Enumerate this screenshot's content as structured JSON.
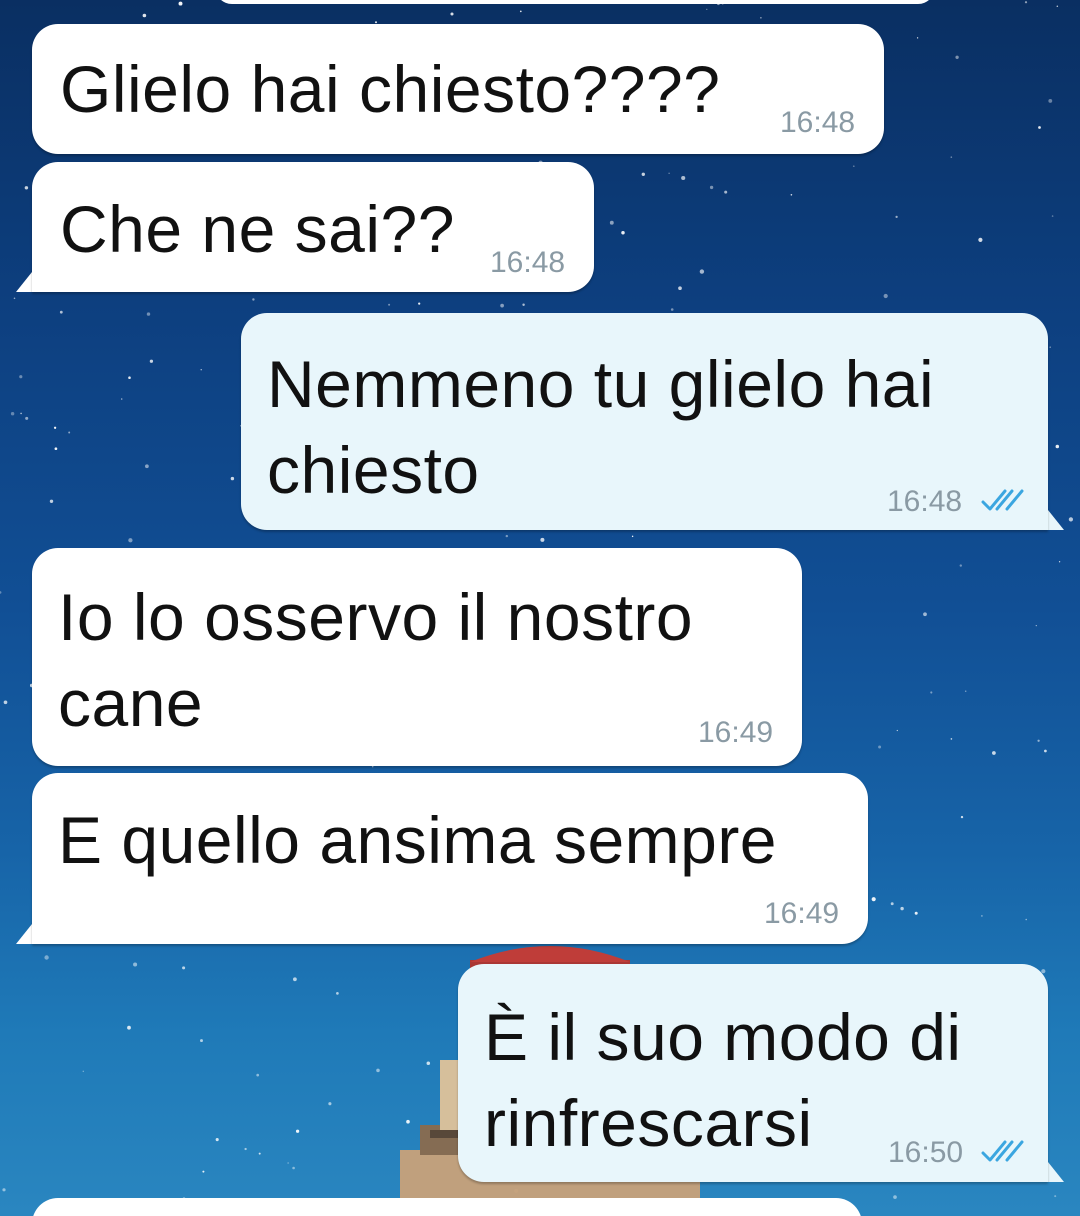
{
  "messages": [
    {
      "direction": "incoming",
      "text": "Glielo hai chiesto????",
      "time": "16:48"
    },
    {
      "direction": "incoming",
      "text": "Che ne sai??",
      "time": "16:48"
    },
    {
      "direction": "outgoing",
      "text": "Nemmeno tu glielo hai\nchiesto",
      "time": "16:48",
      "status": "read"
    },
    {
      "direction": "incoming",
      "text": "Io lo osservo il nostro\ncane",
      "time": "16:49"
    },
    {
      "direction": "incoming",
      "text": "E quello ansima sempre",
      "time": "16:49"
    },
    {
      "direction": "outgoing",
      "text": "È il suo modo di\nrinfrescarsi",
      "time": "16:50",
      "status": "read"
    }
  ],
  "icons": {
    "read_receipt": "double-check-icon"
  },
  "colors": {
    "incoming_bubble": "#ffffff",
    "outgoing_bubble": "#e8f6fb",
    "timestamp": "#8a9aa4",
    "read_check": "#3ba6e0"
  }
}
